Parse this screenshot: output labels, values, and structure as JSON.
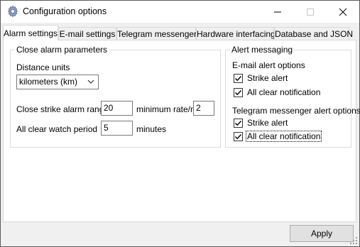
{
  "window": {
    "title": "Configuration options",
    "icons": {
      "app": "gear-icon",
      "minimize": "minimize-icon",
      "maximize": "maximize-icon",
      "close": "close-icon"
    }
  },
  "tabs": [
    {
      "label": "Alarm settings",
      "active": true
    },
    {
      "label": "E-mail settings",
      "active": false
    },
    {
      "label": "Telegram messenger",
      "active": false
    },
    {
      "label": "Hardware interfacing",
      "active": false
    },
    {
      "label": "Database and JSON",
      "active": false
    }
  ],
  "close_alarm": {
    "title": "Close alarm parameters",
    "distance_units_label": "Distance units",
    "distance_units_value": "kilometers (km)",
    "strike_range_label": "Close strike alarm range",
    "strike_range_value": "20",
    "min_rate_label": "minimum rate/m",
    "min_rate_value": "2",
    "watch_period_label": "All clear watch period",
    "watch_period_value": "5",
    "minutes_label": "minutes"
  },
  "alert_messaging": {
    "title": "Alert messaging",
    "email_heading": "E-mail alert options",
    "email_strike_label": "Strike alert",
    "email_strike_checked": true,
    "email_clear_label": "All clear notification",
    "email_clear_checked": true,
    "telegram_heading": "Telegram messenger alert options",
    "telegram_strike_label": "Strike alert",
    "telegram_strike_checked": true,
    "telegram_clear_label": "All clear notification",
    "telegram_clear_checked": true
  },
  "apply_label": "Apply"
}
